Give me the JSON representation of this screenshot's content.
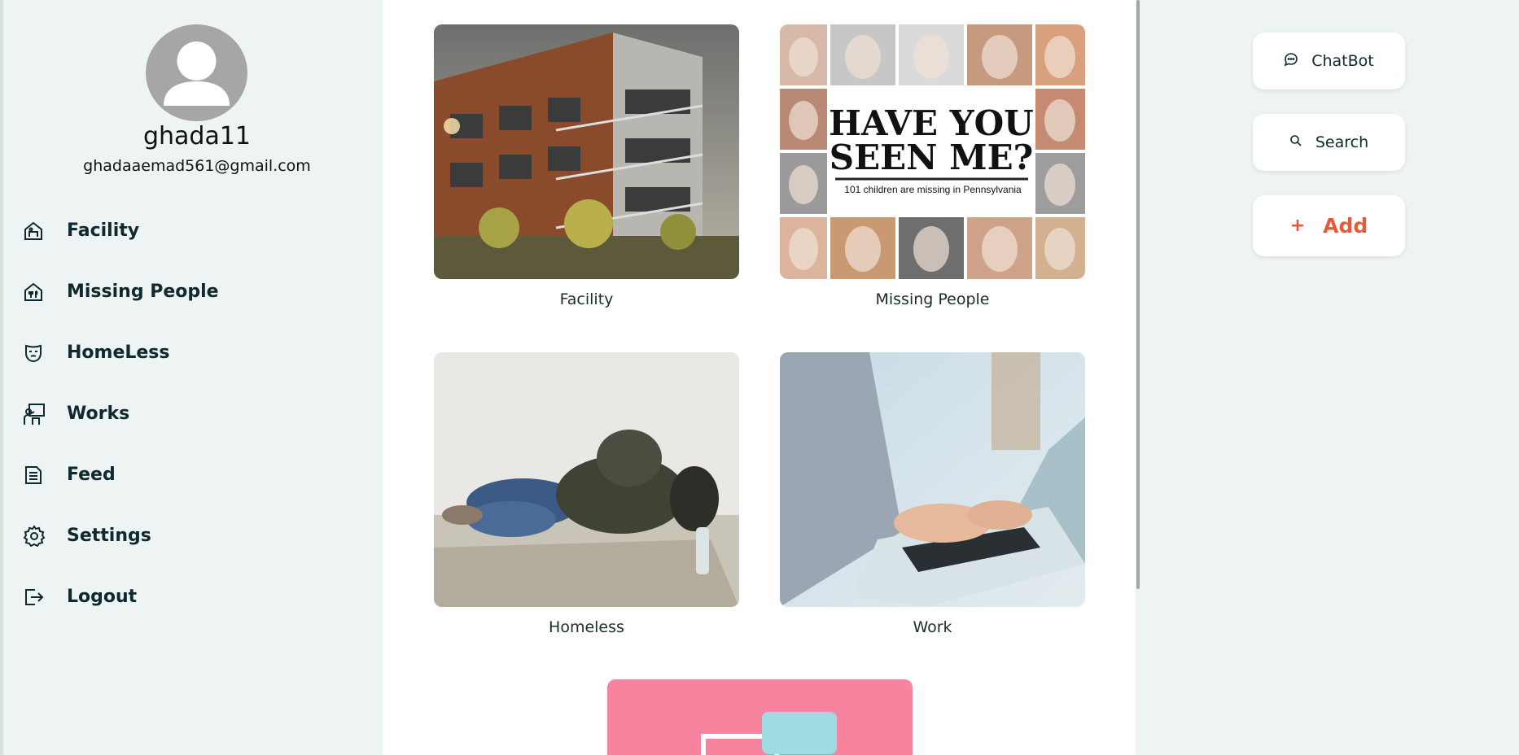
{
  "user": {
    "username": "ghada11",
    "email": "ghadaaemad561@gmail.com"
  },
  "sidebar": {
    "items": [
      {
        "label": "Facility",
        "icon": "facility-icon"
      },
      {
        "label": "Missing People",
        "icon": "missing-people-icon"
      },
      {
        "label": "HomeLess",
        "icon": "mask-icon"
      },
      {
        "label": "Works",
        "icon": "work-icon"
      },
      {
        "label": "Feed",
        "icon": "document-icon"
      },
      {
        "label": "Settings",
        "icon": "gear-icon"
      },
      {
        "label": "Logout",
        "icon": "logout-icon"
      }
    ]
  },
  "categories": [
    {
      "caption": "Facility",
      "image": "building-photo"
    },
    {
      "caption": "Missing People",
      "image": "missing-children-poster",
      "poster_title_1": "HAVE YOU",
      "poster_title_2": "SEEN ME?",
      "poster_subtitle": "101 children are missing in Pennsylvania"
    },
    {
      "caption": "Homeless",
      "image": "homeless-person-photo"
    },
    {
      "caption": "Work",
      "image": "laptop-typing-photo"
    }
  ],
  "actions": {
    "chatbot_label": "ChatBot",
    "search_label": "Search",
    "add_plus": "+",
    "add_label": "Add"
  },
  "colors": {
    "accent": "#e65a3c",
    "text_dark": "#0f2a2f",
    "background": "#eef3f3"
  }
}
